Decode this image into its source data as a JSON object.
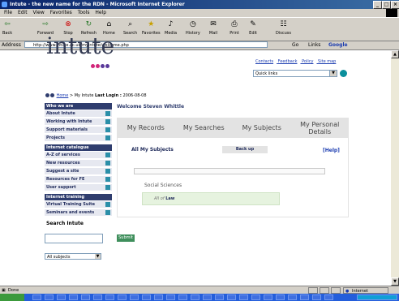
{
  "window": {
    "title": "Intute - the new name for the RDN - Microsoft Internet Explorer"
  },
  "menu": [
    "File",
    "Edit",
    "View",
    "Favorites",
    "Tools",
    "Help"
  ],
  "toolbar": [
    {
      "label": "Back",
      "icon": "back-arrow-icon"
    },
    {
      "label": "Forward",
      "icon": "forward-arrow-icon"
    },
    {
      "label": "Stop",
      "icon": "stop-icon"
    },
    {
      "label": "Refresh",
      "icon": "refresh-icon"
    },
    {
      "label": "Home",
      "icon": "home-icon"
    },
    {
      "label": "Search",
      "icon": "search-icon"
    },
    {
      "label": "Favorites",
      "icon": "favorites-icon"
    },
    {
      "label": "Media",
      "icon": "media-icon"
    },
    {
      "label": "History",
      "icon": "history-icon"
    },
    {
      "label": "Mail",
      "icon": "mail-icon"
    },
    {
      "label": "Print",
      "icon": "print-icon"
    },
    {
      "label": "Edit",
      "icon": "edit-icon"
    },
    {
      "label": "Discuss",
      "icon": "discuss-icon"
    }
  ],
  "address": {
    "label": "Address",
    "url": "http://www.intute.ac.uk/myintute/welcome.php",
    "go_label": "Go",
    "links_label": "Links",
    "google_label": "Google"
  },
  "page": {
    "logo": "intute",
    "top_links": [
      "Contacts",
      "Feedback",
      "Policy",
      "Site map"
    ],
    "quick_links": "Quick links",
    "breadcrumb": {
      "home": "Home",
      "rest": "> My Intute",
      "last_login_label": "Last Login :",
      "last_login": "2006-08-08"
    },
    "welcome": "Welcome Steven Whittle",
    "tabs": [
      "My Records",
      "My Searches",
      "My Subjects",
      "My Personal Details"
    ],
    "all_subjects": "All My Subjects",
    "back_up": "Back up",
    "help": "[Help]",
    "subject_group": "Social Sciences",
    "subject_prefix": "All of",
    "subject": "Law",
    "submit": "Submit"
  },
  "sidebar": {
    "sections": [
      {
        "title": "Who we are",
        "items": [
          "About Intute",
          "Working with Intute",
          "Support materials",
          "Projects"
        ]
      },
      {
        "title": "Internet catalogue",
        "items": [
          "A-Z of services",
          "New resources",
          "Suggest a site",
          "Resources for FE",
          "User support"
        ]
      },
      {
        "title": "Internet training",
        "items": [
          "Virtual Training Suite",
          "Seminars and events"
        ]
      }
    ],
    "search_label": "Search Intute",
    "search_select": "All subjects"
  },
  "status": {
    "left": "Done",
    "zone": "Internet"
  },
  "colors": {
    "navy": "#2f3d6e",
    "accent_teal": "#2b8fa8",
    "green": "#3f8f5c",
    "dot_pink": "#d1267a",
    "dot_purple": "#5a3a9a"
  }
}
